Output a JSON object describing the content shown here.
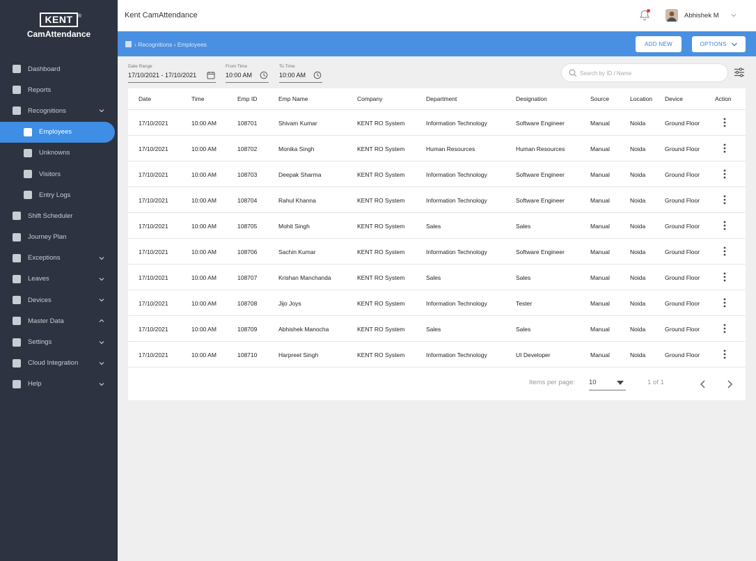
{
  "brand": {
    "logo_text": "KENT",
    "logo_mark": "®",
    "app_name": "CamAttendance"
  },
  "sidebar": {
    "items": [
      {
        "label": "Dashboard",
        "chevron": ""
      },
      {
        "label": "Reports",
        "chevron": ""
      },
      {
        "label": "Recognitions",
        "chevron": "down"
      },
      {
        "label": "Employees",
        "chevron": "",
        "sub": true,
        "active": true
      },
      {
        "label": "Unknowns",
        "chevron": "",
        "sub": true
      },
      {
        "label": "Visitors",
        "chevron": "",
        "sub": true
      },
      {
        "label": "Entry Logs",
        "chevron": "",
        "sub": true
      },
      {
        "label": "Shift Scheduler",
        "chevron": ""
      },
      {
        "label": "Journey Plan",
        "chevron": ""
      },
      {
        "label": "Exceptions",
        "chevron": "down"
      },
      {
        "label": "Leaves",
        "chevron": "down"
      },
      {
        "label": "Devices",
        "chevron": "down"
      },
      {
        "label": "Master Data",
        "chevron": "up"
      },
      {
        "label": "Settings",
        "chevron": "down"
      },
      {
        "label": "Cloud Integration",
        "chevron": "down"
      },
      {
        "label": "Help",
        "chevron": "down"
      }
    ]
  },
  "header": {
    "title": "Kent CamAttendance",
    "user_name": "Abhishek M"
  },
  "toolbar": {
    "breadcrumb": "› Recognitions › Employees",
    "add_new_label": "ADD NEW",
    "options_label": "OPTIONS"
  },
  "filters": {
    "date_range_label": "Date Range",
    "date_range_value": "17/10/2021 - 17/10/2021",
    "from_time_label": "From Time",
    "from_time_value": "10:00 AM",
    "to_time_label": "To Time",
    "to_time_value": "10:00 AM",
    "search_placeholder": "Search by ID / Name"
  },
  "table": {
    "columns": [
      "Date",
      "Time",
      "Emp ID",
      "Emp Name",
      "Company",
      "Department",
      "Designation",
      "Source",
      "Location",
      "Device",
      "Action"
    ],
    "rows": [
      [
        "17/10/2021",
        "10:00 AM",
        "108701",
        "Shivam Kumar",
        "KENT RO System",
        "Information Technology",
        "Software Engineer",
        "Manual",
        "Noida",
        "Ground Floor"
      ],
      [
        "17/10/2021",
        "10:00 AM",
        "108702",
        "Monika Singh",
        "KENT RO System",
        "Human Resources",
        "Human Resources",
        "Manual",
        "Noida",
        "Ground Floor"
      ],
      [
        "17/10/2021",
        "10:00 AM",
        "108703",
        "Deepak Sharma",
        "KENT RO System",
        "Information Technology",
        "Software Engineer",
        "Manual",
        "Noida",
        "Ground Floor"
      ],
      [
        "17/10/2021",
        "10:00 AM",
        "108704",
        "Rahul Khanna",
        "KENT RO System",
        "Information Technology",
        "Software Engineer",
        "Manual",
        "Noida",
        "Ground Floor"
      ],
      [
        "17/10/2021",
        "10:00 AM",
        "108705",
        "Mohit Singh",
        "KENT RO System",
        "Sales",
        "Sales",
        "Manual",
        "Noida",
        "Ground Floor"
      ],
      [
        "17/10/2021",
        "10:00 AM",
        "108706",
        "Sachin Kumar",
        "KENT RO System",
        "Information Technology",
        "Software Engineer",
        "Manual",
        "Noida",
        "Ground Floor"
      ],
      [
        "17/10/2021",
        "10:00 AM",
        "108707",
        "Krishan Manchanda",
        "KENT RO System",
        "Sales",
        "Sales",
        "Manual",
        "Noida",
        "Ground Floor"
      ],
      [
        "17/10/2021",
        "10:00 AM",
        "108708",
        "Jijo Joys",
        "KENT RO System",
        "Information Technology",
        "Tester",
        "Manual",
        "Noida",
        "Ground Floor"
      ],
      [
        "17/10/2021",
        "10:00 AM",
        "108709",
        "Abhishek Manocha",
        "KENT RO System",
        "Sales",
        "Sales",
        "Manual",
        "Noida",
        "Ground Floor"
      ],
      [
        "17/10/2021",
        "10:00 AM",
        "108710",
        "Harpreet Singh",
        "KENT RO System",
        "Information Technology",
        "UI Developer",
        "Manual",
        "Noida",
        "Ground Floor"
      ]
    ]
  },
  "pagination": {
    "items_per_page_label": "Items per page:",
    "items_per_page_value": "10",
    "range_text": "1 of 1"
  },
  "colors": {
    "sidebar_bg": "#2d3340",
    "accent": "#4a90e2",
    "active_item": "#3d8ee4",
    "notification_dot": "#e53935"
  },
  "icons": {
    "bell": "bell-icon",
    "calendar": "calendar-icon",
    "clock": "clock-icon",
    "search": "search-icon",
    "filter": "filter-sliders-icon",
    "kebab": "more-vertical-icon",
    "chevron": "chevron-down-icon"
  }
}
